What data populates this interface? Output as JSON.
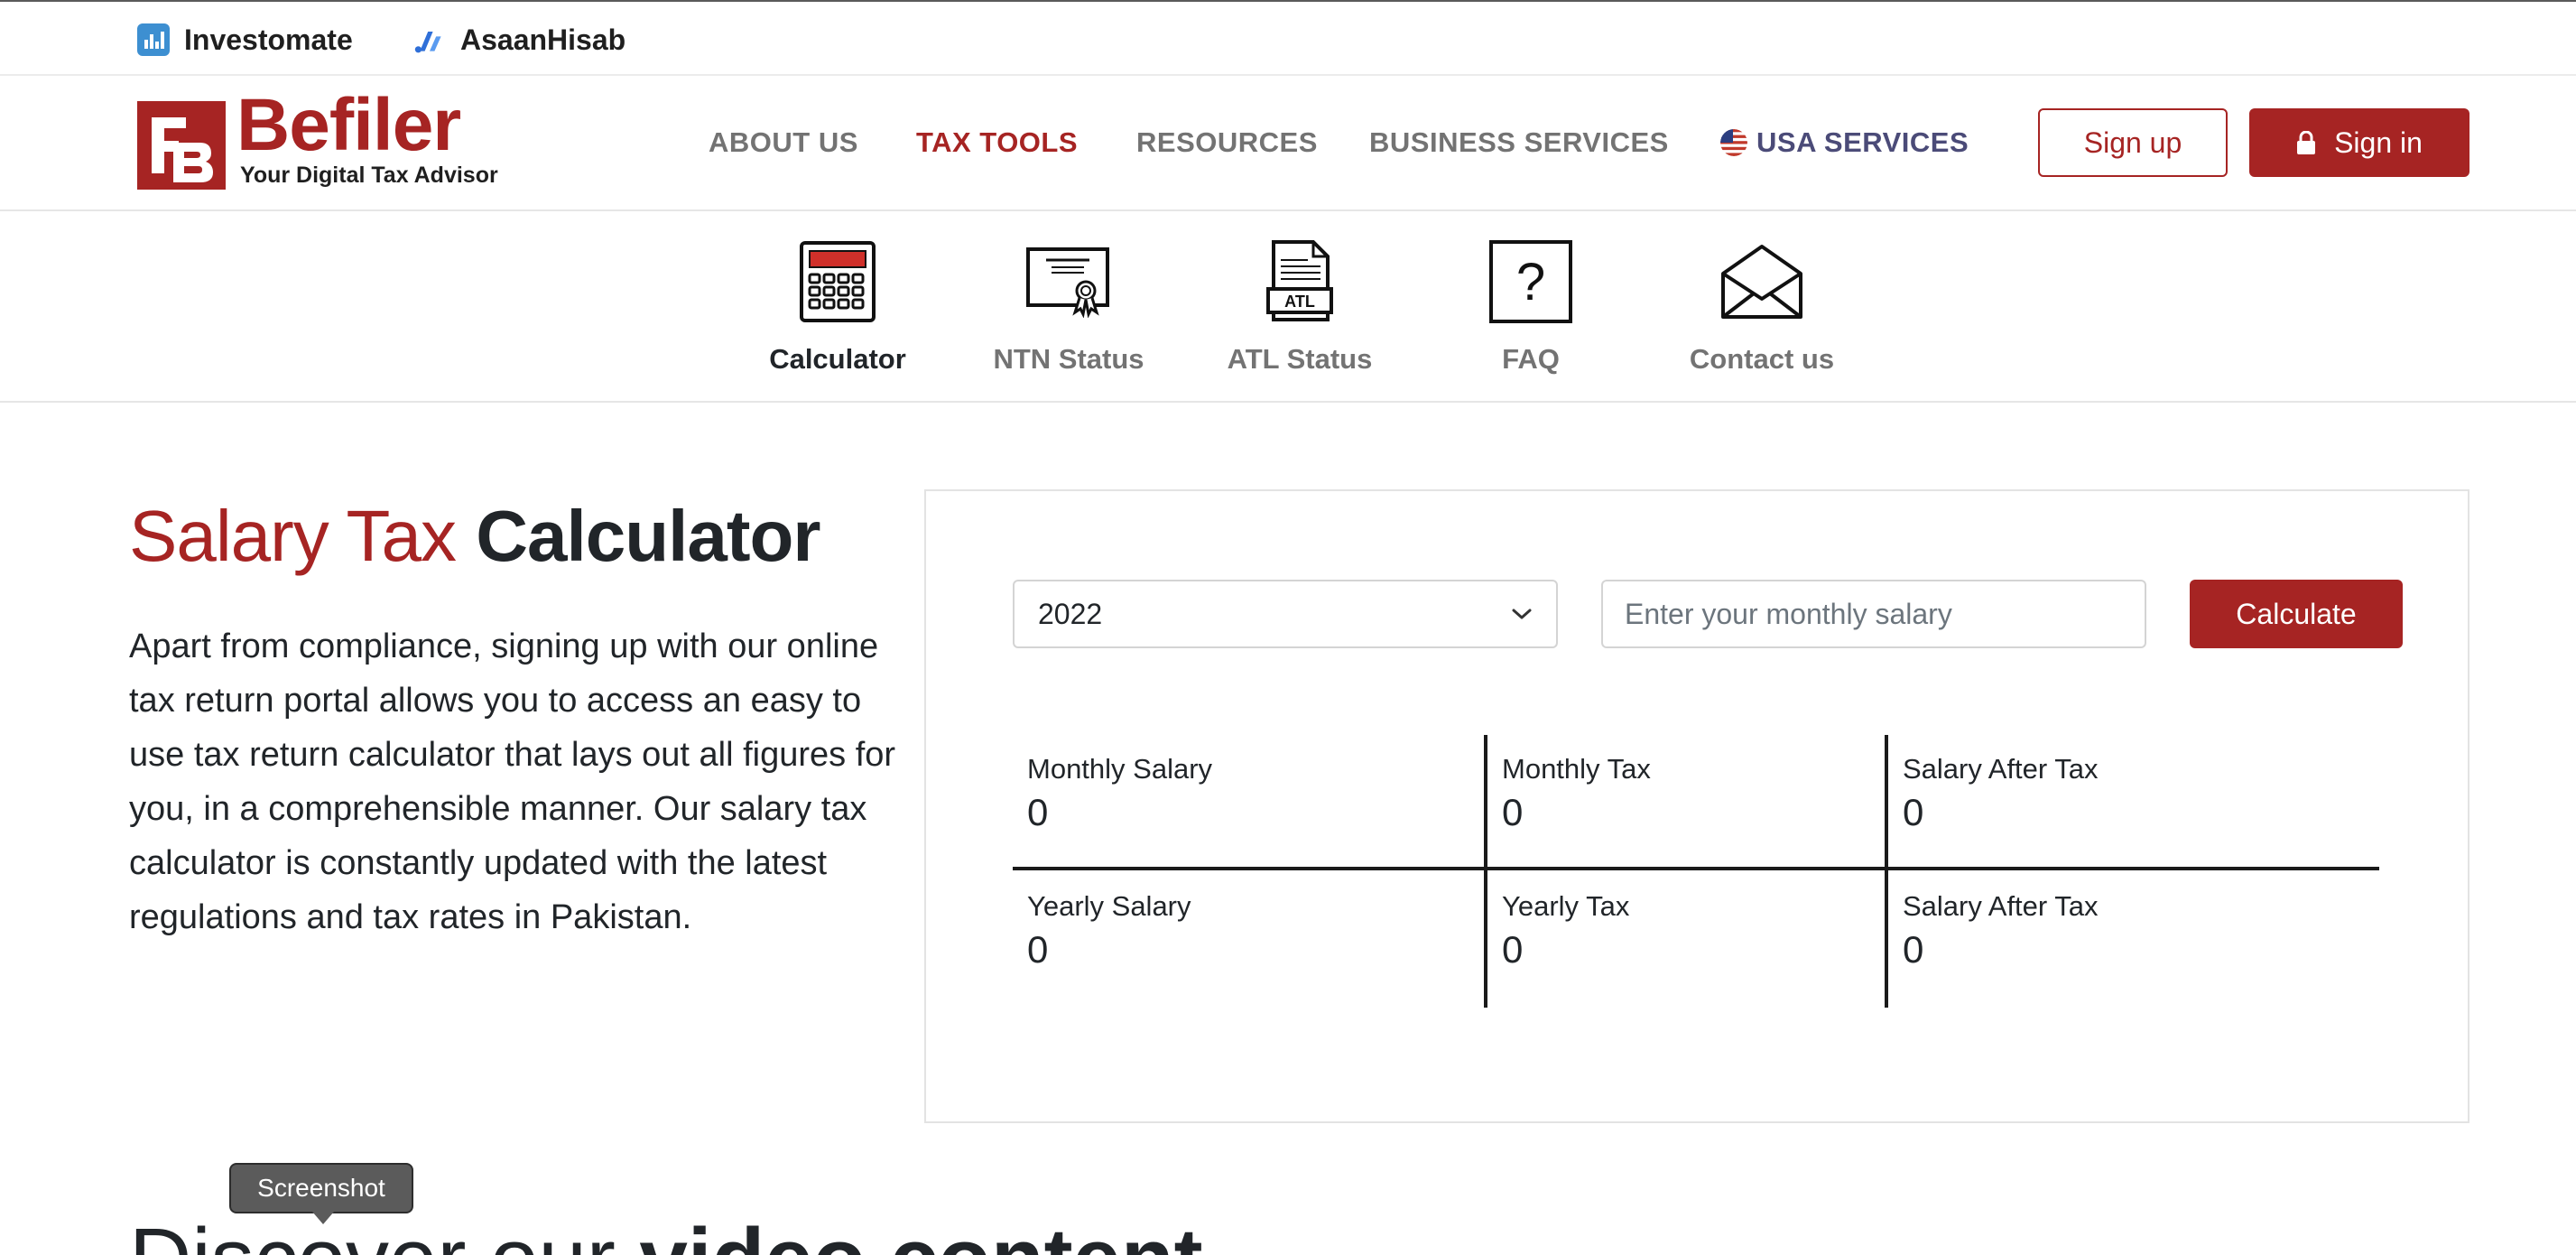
{
  "topbar": {
    "links": [
      {
        "label": "Investomate",
        "icon": "investomate-logo-icon"
      },
      {
        "label": "AsaanHisab",
        "icon": "asaanhisab-logo-icon"
      }
    ]
  },
  "header": {
    "brand": {
      "name": "Befiler",
      "tagline": "Your Digital Tax Advisor",
      "color": "#a62423"
    },
    "nav": [
      "ABOUT US",
      "TAX TOOLS",
      "RESOURCES",
      "BUSINESS SERVICES",
      "USA SERVICES"
    ],
    "active_nav": "TAX TOOLS",
    "signup_label": "Sign up",
    "signin_label": "Sign in"
  },
  "tools": [
    {
      "label": "Calculator",
      "icon": "calculator-icon",
      "active": true
    },
    {
      "label": "NTN Status",
      "icon": "certificate-icon",
      "active": false
    },
    {
      "label": "ATL Status",
      "icon": "atl-document-icon",
      "active": false,
      "icon_text": "ATL"
    },
    {
      "label": "FAQ",
      "icon": "question-icon",
      "active": false,
      "icon_text": "?"
    },
    {
      "label": "Contact us",
      "icon": "envelope-icon",
      "active": false
    }
  ],
  "hero": {
    "title_light": "Salary Tax",
    "title_bold": "Calculator",
    "description": "Apart from compliance, signing up with our online tax return portal allows you to access an easy to use tax return calculator that lays out all figures for you, in a comprehensible manner. Our salary tax calculator is constantly updated with the latest regulations and tax rates in Pakistan."
  },
  "calculator": {
    "year": "2022",
    "salary_placeholder": "Enter your monthly salary",
    "button_label": "Calculate",
    "results": [
      {
        "label": "Monthly Salary",
        "value": "0"
      },
      {
        "label": "Monthly Tax",
        "value": "0"
      },
      {
        "label": "Salary After Tax",
        "value": "0"
      },
      {
        "label": "Yearly Salary",
        "value": "0"
      },
      {
        "label": "Yearly Tax",
        "value": "0"
      },
      {
        "label": "Salary After Tax",
        "value": "0"
      }
    ]
  },
  "tooltip": "Screenshot",
  "discover": {
    "light": "Discover our",
    "bold": "video content"
  },
  "colors": {
    "brand_red": "#a62423",
    "nav_gray": "#737373",
    "text_dark": "#212529"
  }
}
